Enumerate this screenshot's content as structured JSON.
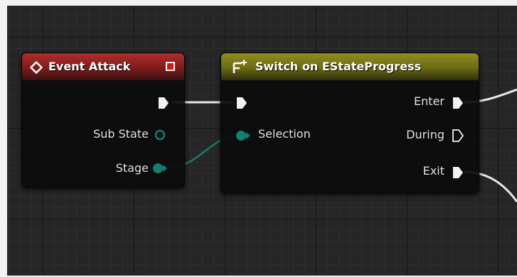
{
  "nodes": {
    "event_attack": {
      "title": "Event Attack",
      "pins": {
        "sub_state": "Sub State",
        "stage": "Stage"
      }
    },
    "switch_estate_progress": {
      "title": "Switch on EStateProgress",
      "pins": {
        "selection": "Selection",
        "enter": "Enter",
        "during": "During",
        "exit": "Exit"
      }
    }
  },
  "colors": {
    "exec_pin": "#f2f2f2",
    "enum_pin": "#147e72",
    "event_header": "#b02d2d",
    "switch_header": "#8f8f1e",
    "grid_background": "#262626"
  },
  "icons": {
    "event_header": "diamond-outline-icon",
    "switch_header": "switch-function-icon",
    "delegate": "red-square-delegate-icon"
  }
}
